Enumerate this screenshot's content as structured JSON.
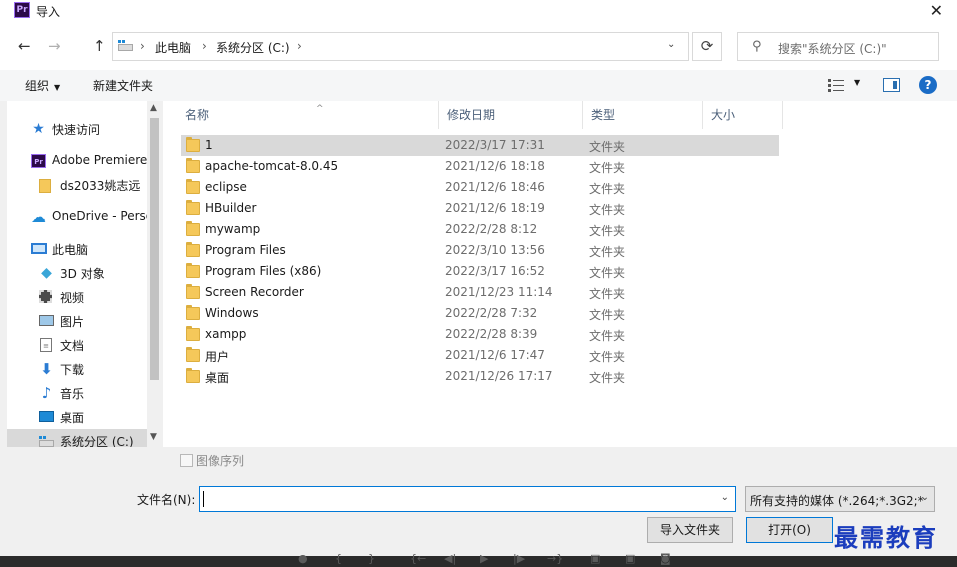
{
  "window": {
    "title": "导入",
    "app_icon": "Pr",
    "close": "✕"
  },
  "nav": {
    "back": "←",
    "forward": "→",
    "up": "↑",
    "breadcrumb": [
      "此电脑",
      "系统分区 (C:)"
    ],
    "refresh": "⟳",
    "search_placeholder": "搜索\"系统分区 (C:)\""
  },
  "commands": {
    "organize": "组织",
    "new_folder": "新建文件夹"
  },
  "sidebar": {
    "items": [
      {
        "label": "快速访问",
        "icon": "star-icon"
      },
      {
        "label": "Adobe Premiere",
        "icon": "premiere-icon"
      },
      {
        "label": "ds2033姚志远",
        "icon": "folder-icon"
      },
      {
        "label": "OneDrive - Perso",
        "icon": "onedrive-icon"
      },
      {
        "label": "此电脑",
        "icon": "computer-icon"
      },
      {
        "label": "3D 对象",
        "icon": "3d-objects-icon"
      },
      {
        "label": "视频",
        "icon": "video-icon"
      },
      {
        "label": "图片",
        "icon": "pictures-icon"
      },
      {
        "label": "文档",
        "icon": "documents-icon"
      },
      {
        "label": "下载",
        "icon": "download-icon"
      },
      {
        "label": "音乐",
        "icon": "music-icon"
      },
      {
        "label": "桌面",
        "icon": "desktop-icon"
      },
      {
        "label": "系统分区 (C:)",
        "icon": "drive-icon"
      }
    ]
  },
  "columns": {
    "name": "名称",
    "modified": "修改日期",
    "type": "类型",
    "size": "大小"
  },
  "files": [
    {
      "name": "1",
      "modified": "2022/3/17 17:31",
      "type": "文件夹"
    },
    {
      "name": "apache-tomcat-8.0.45",
      "modified": "2021/12/6 18:18",
      "type": "文件夹"
    },
    {
      "name": "eclipse",
      "modified": "2021/12/6 18:46",
      "type": "文件夹"
    },
    {
      "name": "HBuilder",
      "modified": "2021/12/6 18:19",
      "type": "文件夹"
    },
    {
      "name": "mywamp",
      "modified": "2022/2/28 8:12",
      "type": "文件夹"
    },
    {
      "name": "Program Files",
      "modified": "2022/3/10 13:56",
      "type": "文件夹"
    },
    {
      "name": "Program Files (x86)",
      "modified": "2022/3/17 16:52",
      "type": "文件夹"
    },
    {
      "name": "Screen Recorder",
      "modified": "2021/12/23 11:14",
      "type": "文件夹"
    },
    {
      "name": "Windows",
      "modified": "2022/2/28 7:32",
      "type": "文件夹"
    },
    {
      "name": "xampp",
      "modified": "2022/2/28 8:39",
      "type": "文件夹"
    },
    {
      "name": "用户",
      "modified": "2021/12/6 17:47",
      "type": "文件夹"
    },
    {
      "name": "桌面",
      "modified": "2021/12/26 17:17",
      "type": "文件夹"
    }
  ],
  "footer": {
    "image_sequence": "图像序列",
    "filename_label": "文件名(N):",
    "filename_value": "",
    "filter": "所有支持的媒体 (*.264;*.3G2;*",
    "import_folder": "导入文件夹",
    "open": "打开(O)"
  },
  "watermark": "最需教育"
}
